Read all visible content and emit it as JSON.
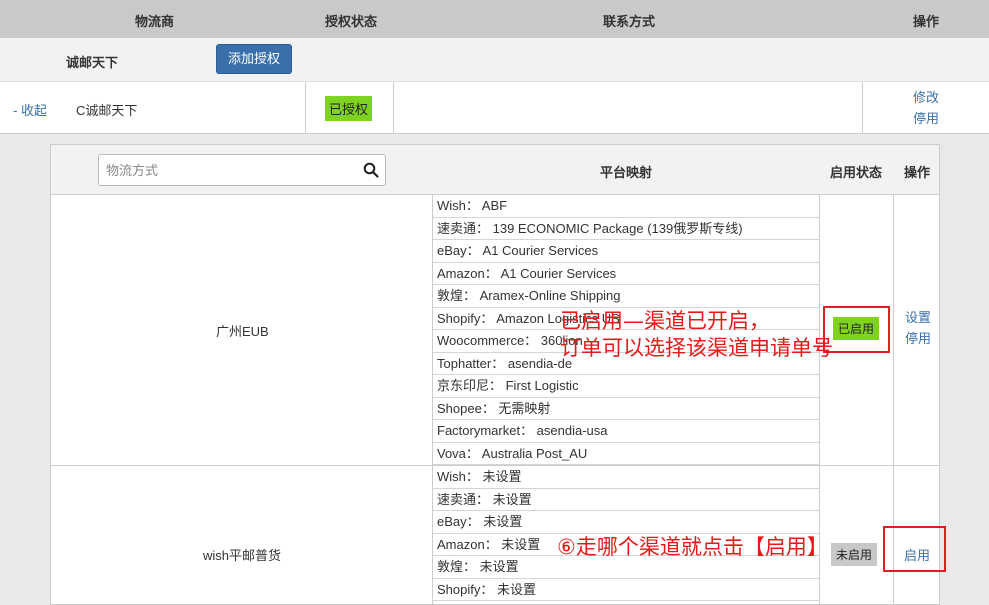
{
  "header": {
    "carrier": "物流商",
    "auth_status": "授权状态",
    "contact": "联系方式",
    "action": "操作"
  },
  "controls": {
    "carrier_name": "诚邮天下",
    "add_auth_label": "添加授权"
  },
  "carrier_row": {
    "collapse_label": "- 收起",
    "name": "C诚邮天下",
    "status": "已授权",
    "edit_label": "修改",
    "disable_label": "停用"
  },
  "channel_table": {
    "search_placeholder": "物流方式",
    "col_mapping": "平台映射",
    "col_status": "启用状态",
    "col_action": "操作"
  },
  "channels": [
    {
      "name": "广州EUB",
      "mappings": [
        "Wish：  ABF",
        "速卖通：  139 ECONOMIC Package (139俄罗斯专线)",
        "eBay：  A1 Courier Services",
        "Amazon：  A1 Courier Services",
        "敦煌：  Aramex-Online Shipping",
        "Shopify：  Amazon Logistics US",
        "Woocommerce：  360lion",
        "Tophatter：  asendia-de",
        "京东印尼：  First Logistic",
        "Shopee：  无需映射",
        "Factorymarket：  asendia-usa",
        "Vova：  Australia Post_AU"
      ],
      "status": "已启用",
      "setup_label": "设置",
      "disable_label": "停用"
    },
    {
      "name": "wish平邮普货",
      "mappings": [
        "Wish：  未设置",
        "速卖通：  未设置",
        "eBay：  未设置",
        "Amazon：  未设置",
        "敦煌：  未设置",
        "Shopify：  未设置"
      ],
      "status": "未启用",
      "enable_label": "启用"
    }
  ],
  "annotations": {
    "enabled_note_line1": "已启用—渠道已开启，",
    "enabled_note_line2": "订单可以选择该渠道申请单号",
    "step6_note": "⑥走哪个渠道就点击【启用】"
  },
  "colors": {
    "header_bg": "#c9c9c9",
    "primary_button": "#3a6fac",
    "badge_green": "#7ed321",
    "badge_gray": "#c8c8c8",
    "link": "#3a6fac",
    "annotation_red": "#e81818"
  }
}
